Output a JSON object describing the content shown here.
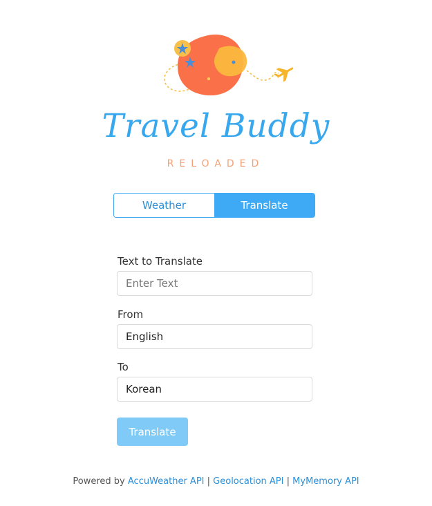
{
  "brand": {
    "title": "Travel Buddy",
    "subtitle": "RELOADED"
  },
  "tabs": [
    {
      "label": "Weather",
      "active": false
    },
    {
      "label": "Translate",
      "active": true
    }
  ],
  "form": {
    "text_label": "Text to Translate",
    "text_placeholder": "Enter Text",
    "text_value": "",
    "from_label": "From",
    "from_value": "English",
    "to_label": "To",
    "to_value": "Korean",
    "submit_label": "Translate"
  },
  "footer": {
    "prefix": "Powered by",
    "links": [
      "AccuWeather API",
      "Geolocation API",
      "MyMemory API"
    ],
    "separator": "|"
  },
  "colors": {
    "accent": "#3ea9f5",
    "button_disabled": "#7fcaf7",
    "brand_blue": "#38a8ee",
    "brand_orange": "#f4a076"
  },
  "icons": [
    "globe-logo-icon",
    "airplane-icon",
    "star-icon"
  ]
}
